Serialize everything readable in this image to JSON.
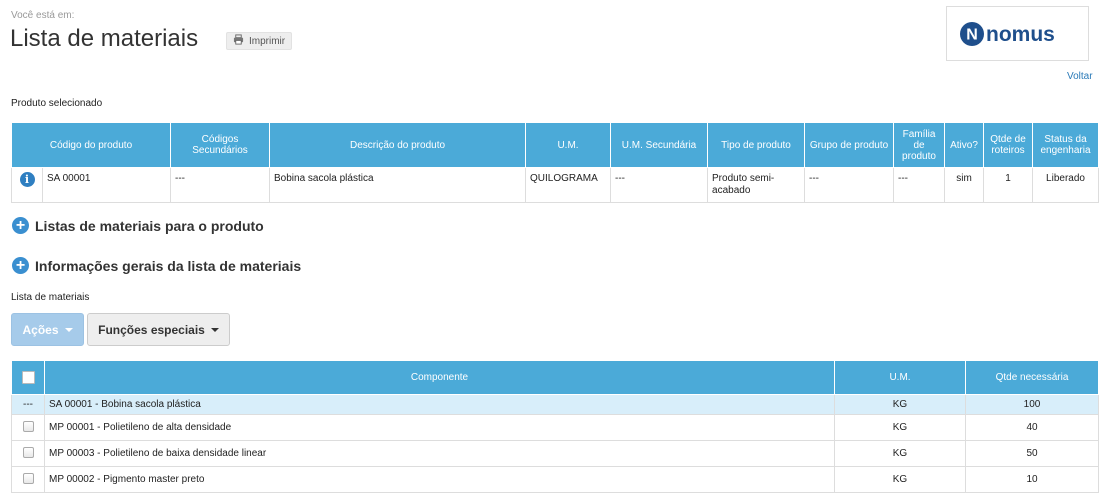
{
  "breadcrumb": "Você está em:",
  "page_title": "Lista de materiais",
  "print_label": "Imprimir",
  "logo_text": "nomus",
  "voltar_label": "Voltar",
  "produto_selecionado_label": "Produto selecionado",
  "product_table": {
    "headers": [
      "Código do produto",
      "Códigos Secundários",
      "Descrição do produto",
      "U.M.",
      "U.M. Secundária",
      "Tipo de produto",
      "Grupo de produto",
      "Família de produto",
      "Ativo?",
      "Qtde de roteiros",
      "Status da engenharia"
    ],
    "row": {
      "codigo": "SA 00001",
      "codigos_secundarios": "---",
      "descricao": "Bobina sacola plástica",
      "um": "QUILOGRAMA",
      "um_secundaria": "---",
      "tipo": "Produto semi-acabado",
      "grupo": "---",
      "familia": "---",
      "ativo": "sim",
      "qtde_roteiros": "1",
      "status": "Liberado"
    }
  },
  "sections": {
    "listas_produto": "Listas de materiais para o produto",
    "info_gerais": "Informações gerais da lista de materiais"
  },
  "lista_label": "Lista de materiais",
  "buttons": {
    "acoes": "Ações",
    "funcoes": "Funções especiais"
  },
  "list_table": {
    "headers": [
      "Componente",
      "U.M.",
      "Qtde necessária"
    ],
    "rows": [
      {
        "check": "---",
        "componente": "SA 00001 - Bobina sacola plástica",
        "um": "KG",
        "qtde": "100"
      },
      {
        "check": "",
        "componente": "MP 00001 - Polietileno de alta densidade",
        "um": "KG",
        "qtde": "40"
      },
      {
        "check": "",
        "componente": "MP 00003 - Polietileno de baixa densidade linear",
        "um": "KG",
        "qtde": "50"
      },
      {
        "check": "",
        "componente": "MP 00002 - Pigmento master preto",
        "um": "KG",
        "qtde": "10"
      }
    ]
  },
  "colors": {
    "header_blue": "#4baad8",
    "link_blue": "#2a7ab8",
    "highlight_row": "#d8eefa"
  }
}
